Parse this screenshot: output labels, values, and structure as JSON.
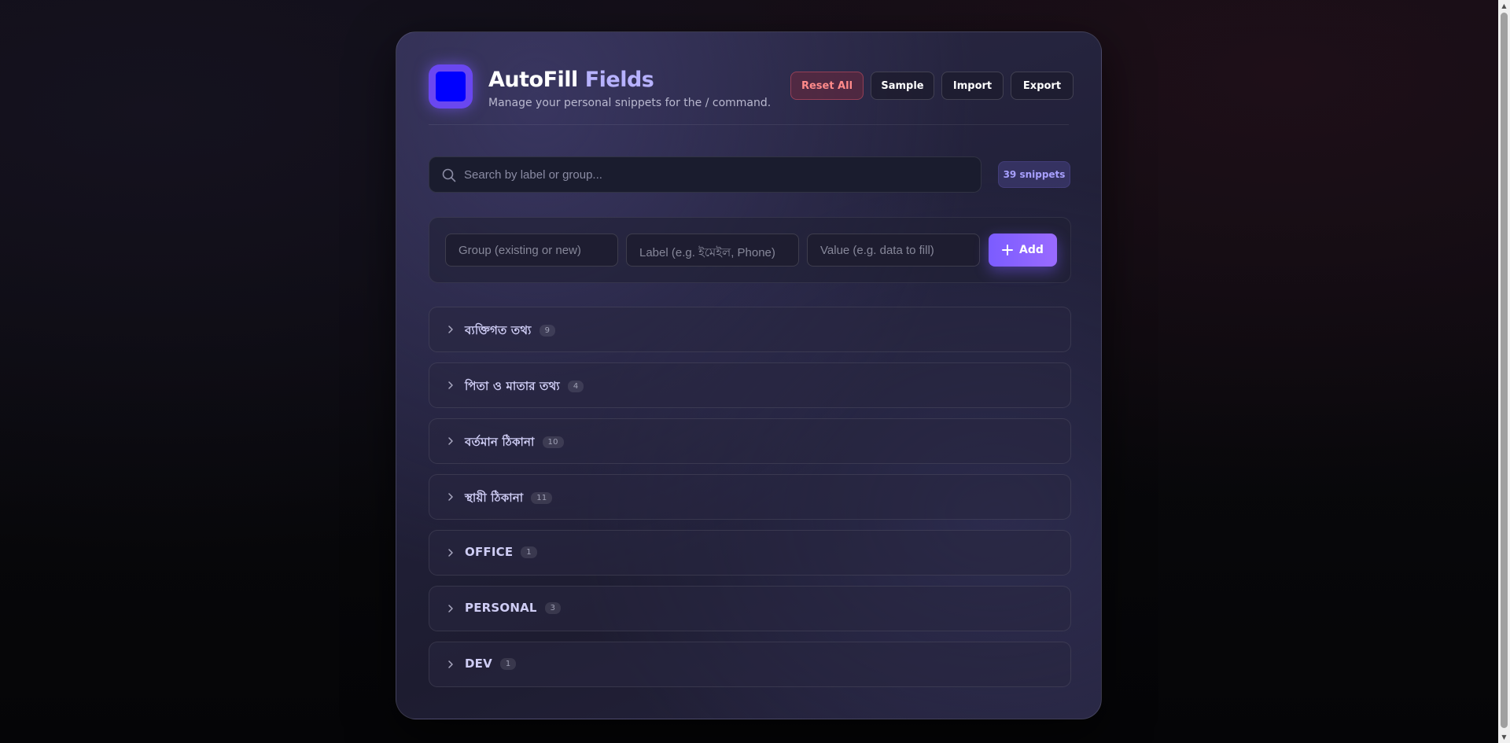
{
  "app": {
    "title_main": "AutoFill",
    "title_accent": "Fields",
    "subtitle": "Manage your personal snippets for the / command."
  },
  "toolbar": {
    "reset_label": "Reset All",
    "sample_label": "Sample",
    "import_label": "Import",
    "export_label": "Export"
  },
  "search": {
    "placeholder": "Search by label or group..."
  },
  "snippet_count": "39 snippets",
  "add_form": {
    "group_placeholder": "Group (existing or new)",
    "label_placeholder": "Label (e.g. ইমেইল, Phone)",
    "value_placeholder": "Value (e.g. data to fill)",
    "add_label": "Add"
  },
  "groups": [
    {
      "name": "ব্যক্তিগত তথ্য",
      "count": "9"
    },
    {
      "name": "পিতা ও মাতার তথ্য",
      "count": "4"
    },
    {
      "name": "বর্তমান ঠিকানা",
      "count": "10"
    },
    {
      "name": "স্থায়ী ঠিকানা",
      "count": "11"
    },
    {
      "name": "OFFICE",
      "count": "1"
    },
    {
      "name": "PERSONAL",
      "count": "3"
    },
    {
      "name": "DEV",
      "count": "1"
    }
  ],
  "colors": {
    "accent": "#7b5cff",
    "danger": "#ff8a8a",
    "logo_inner": "#0000ff"
  }
}
